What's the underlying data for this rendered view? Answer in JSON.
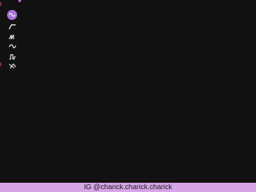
{
  "footer": {
    "credit": "IG @charick.charick.charick"
  },
  "tools": [
    {
      "name": "sine-wave",
      "active": true
    },
    {
      "name": "ramp-wave",
      "active": false
    },
    {
      "name": "saw-wave",
      "active": false
    },
    {
      "name": "smooth-wave",
      "active": false
    },
    {
      "name": "pulse-wave",
      "active": false
    },
    {
      "name": "random-wave",
      "active": false
    }
  ],
  "colors": {
    "background": "#111111",
    "accent": "#a874d7",
    "footer": "#d6a5e6",
    "icon": "#e8e8e8",
    "marker": "#a43a63"
  }
}
